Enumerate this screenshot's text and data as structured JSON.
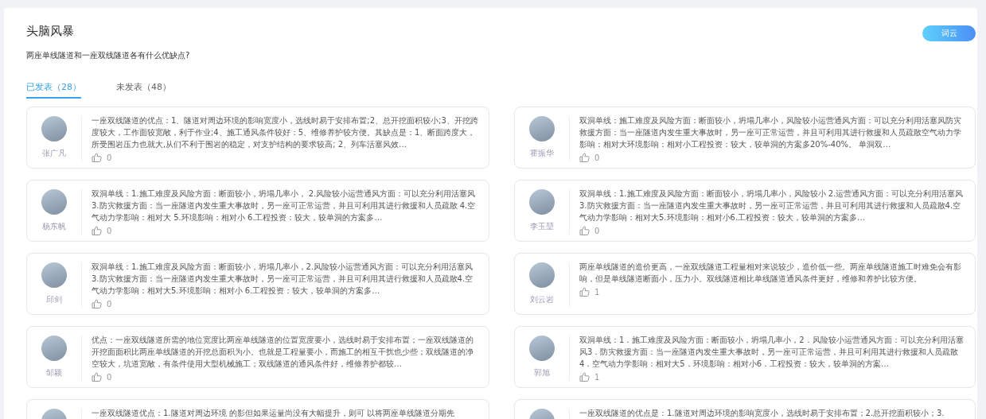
{
  "header": {
    "title": "头脑风暴",
    "question": "两座单线隧道和一座双线隧道各有什么优缺点?",
    "button": "词云"
  },
  "tabs": [
    {
      "label": "已发表（28）",
      "selected": true
    },
    {
      "label": "未发表（48）",
      "selected": false
    }
  ],
  "posts": [
    {
      "author": "张广凡",
      "text": "一座双线隧道的优点：1、隧道对周边环境的影响宽度小，选线时易于安排布置;2、总开挖面积较小;3、开挖跨度较大，工作面较宽敞，利于作业;4、施工通风条件较好：5、维修养护较方便。其缺点是：1、断面跨度大，所受围岩压力也就大,从们不利于围岩的稳定，对支护结构的要求较高; 2、列车活塞风效…",
      "likes": "0"
    },
    {
      "author": "霍振华",
      "text": "双洞单线：施工难度及风险方面：断面较小，坍塌几率小，风险较小运营通风方面：可以充分利用活塞风防灾救援方面：当一座隧道内发生重大事故时，另一座可正常运营，并且可利用其进行救援和人员疏散空气动力学影响：相对大环境影响：相对小工程投资：较大，较单洞的方案多20%-40%。 单洞双…",
      "likes": "0"
    },
    {
      "author": "杨东帆",
      "text": "双洞单线：1.施工难度及风险方面：断面较小，坍塌几率小， 2.风险较小运营通风方面：可以充分利用活塞风 3.防灾救援方面：当一座隧道内发生重大事故时，另一座可正常运营，并且可利用其进行救援和人员疏散 4.空气动力学影响：相对大 5.环境影响：相对小 6.工程投资：较大，较单洞的方案多…",
      "likes": "0"
    },
    {
      "author": "李玉堃",
      "text": "双洞单线：1.施工难度及风险方面：断面较小，坍塌几率小，风险较小 2.运营通风方面：可以充分利用活塞风 3.防灾救援方面：当一座隧道内发生重大事故时，另一座可正常运营，并且可利用其进行救援和人员疏散4.空气动力学影响：相对大5.环境影响：相对小6.工程投资：较大，较单洞的方案多…",
      "likes": "0"
    },
    {
      "author": "邱剑",
      "text": "双洞单线：1.施工难度及风险方面：断面较小，坍塌几率小，2.风险较小运营通风方面：可以充分利用活塞风3.防灾救援方面：当一座隧道内发生重大事故时，另一座可正常运营，并且可利用其进行救援和人员疏散4.空气动力学影响：相对大5.环境影响：相对小 6.工程投资：较大，较单洞的方案多…",
      "likes": "0"
    },
    {
      "author": "刘云岩",
      "text": "两座单线隧道的造价更高，一座双线隧道工程量相对来说较少，造价低一些。两座单线隧道施工时难免会有影响，但是单线隧道断面小，压力小。双线隧道相比单线隧道通风条件更好，维修和养护比较方便。",
      "likes": "1"
    },
    {
      "author": "邹颖",
      "text": "优点：一座双线隧道所需的地位宽度比两座单线隧道的位置宽度要小，选线时易于安排布置；一座双线隧道的开挖面面积比两座单线隧道的开挖总面积为小。也就是工程量要小，而施工的相互干扰也少些；双线隧道的净空较大，坑道宽敞，有条件使用大型机械施工；双线隧道的通风条件好，维修养护都较…",
      "likes": "0"
    },
    {
      "author": "郭旭",
      "text": "双洞单线：1．施工难度及风险方面：断面较小，坍塌几率小，2．风险较小运营通风方面：可以充分利用活塞风3．防灾救援方面：当一座隧道内发生重大事故时，另一座可正常运营，并且可利用其进行救援和人员疏散4．空气动力学影响：相对大5．环境影响：相对小6．工程投资：较大，较单洞的方案…",
      "likes": "1"
    },
    {
      "text": "一座双线隧道优点：1.隧道对周边环境 的影但如果运量尚没有大幅提升，则可 以将两座单线隧道分期先"
    },
    {
      "text": "一座双线隧道的优点是：1.隧道对周边环境的影响宽度小，选线时易于安排布置；2.总开挖面积较小；3."
    }
  ]
}
